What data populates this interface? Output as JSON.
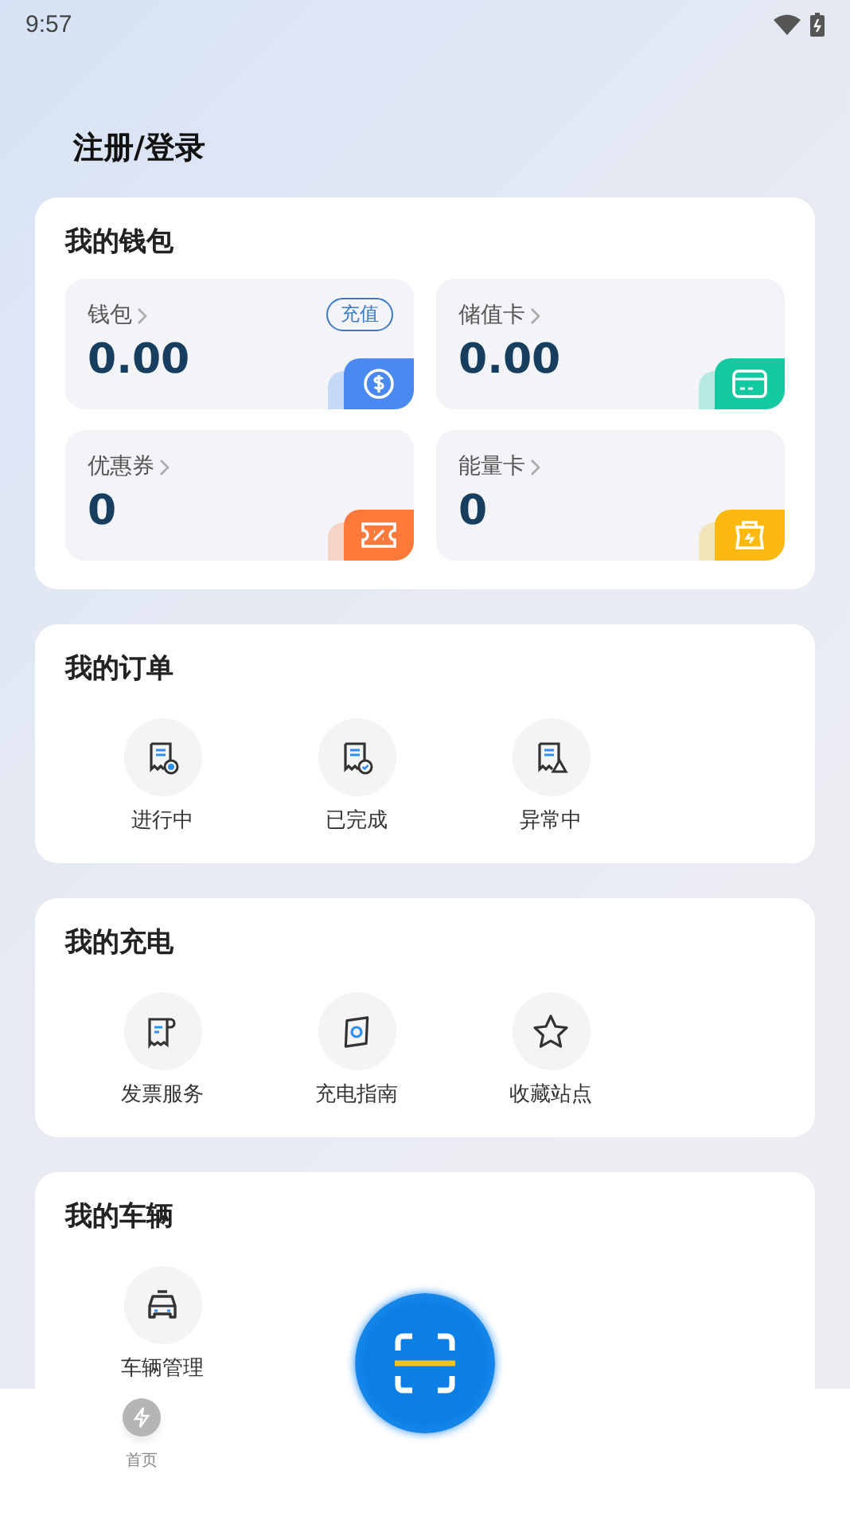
{
  "status_bar": {
    "time": "9:57"
  },
  "title": "注册/登录",
  "wallet": {
    "heading": "我的钱包",
    "tiles": [
      {
        "label": "钱包",
        "value": "0.00",
        "badge": "充值",
        "color": "#4a8af0"
      },
      {
        "label": "储值卡",
        "value": "0.00",
        "color": "#12c9a2"
      },
      {
        "label": "优惠券",
        "value": "0",
        "color": "#ff7a3a"
      },
      {
        "label": "能量卡",
        "value": "0",
        "color": "#fdb90f"
      }
    ]
  },
  "sections": [
    {
      "heading": "我的订单",
      "items": [
        "进行中",
        "已完成",
        "异常中"
      ]
    },
    {
      "heading": "我的充电",
      "items": [
        "发票服务",
        "充电指南",
        "收藏站点"
      ]
    },
    {
      "heading": "我的车辆",
      "items": [
        "车辆管理"
      ]
    }
  ],
  "bottom_nav": {
    "tabs": [
      "首页"
    ]
  }
}
